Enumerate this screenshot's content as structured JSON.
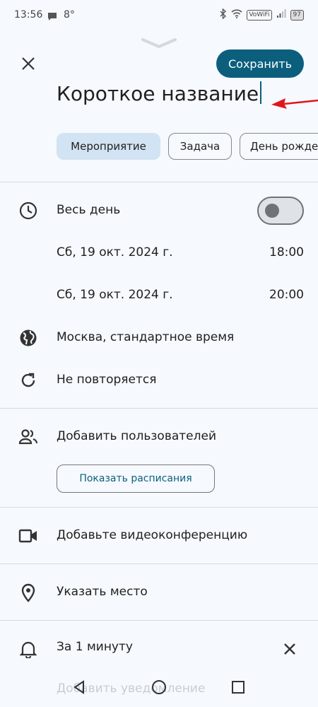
{
  "status_bar": {
    "time": "13:56",
    "temperature": "8°",
    "network_badge": "VoWiFi",
    "battery": "97"
  },
  "header": {
    "save_label": "Сохранить",
    "title_value": "Короткое название"
  },
  "event_types": [
    {
      "label": "Мероприятие",
      "selected": true
    },
    {
      "label": "Задача",
      "selected": false
    },
    {
      "label": "День рождения",
      "selected": false
    }
  ],
  "time_section": {
    "all_day_label": "Весь день",
    "all_day_enabled": false,
    "start_date": "Сб, 19 окт. 2024 г.",
    "start_time": "18:00",
    "end_date": "Сб, 19 окт. 2024 г.",
    "end_time": "20:00",
    "timezone": "Москва, стандартное время",
    "repeat": "Не повторяется"
  },
  "guests": {
    "add_label": "Добавить пользователей",
    "schedules_button": "Показать расписания"
  },
  "video": {
    "label": "Добавьте видеоконференцию"
  },
  "location": {
    "label": "Указать место"
  },
  "notifications": {
    "reminder": "За 1 минуту",
    "add_label": "Добавить уведомление"
  },
  "colors": {
    "accent": "#0b5f7d",
    "chip_selected": "#d2e4f3",
    "annotation_arrow": "#e0151b"
  }
}
